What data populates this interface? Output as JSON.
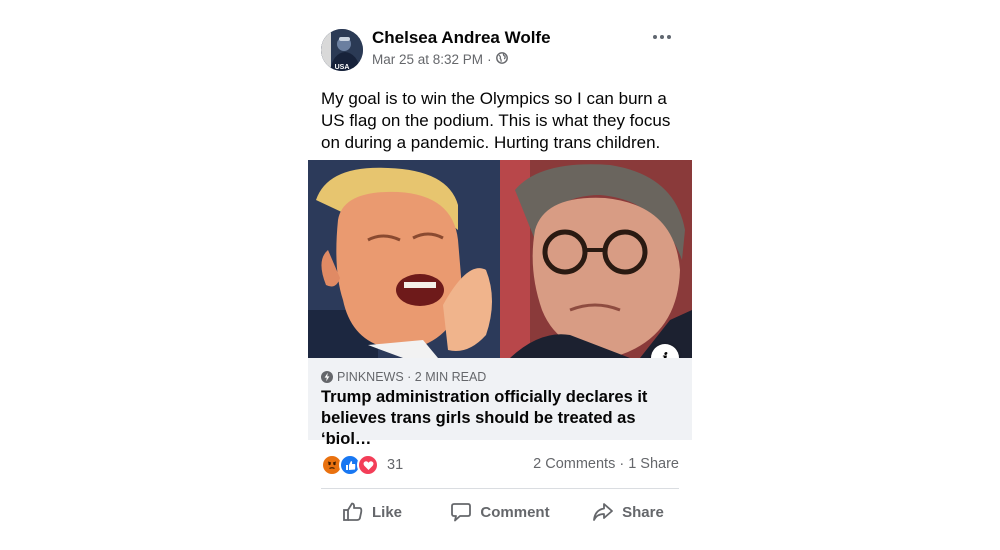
{
  "post": {
    "author": "Chelsea Andrea Wolfe",
    "date": "Mar 25 at 8:32 PM",
    "meta_separator": "·",
    "privacy_icon": "globe-icon",
    "avatar_text": "USA",
    "more_icon": "more-options-icon",
    "text": "My goal is to win the Olympics so I can burn a US flag on the podium. This is what they focus on during a pandemic. Hurting trans children."
  },
  "link_preview": {
    "source": "PinkNews · 2 min read",
    "headline": "Trump administration officially declares it believes trans girls should be treated as ‘biol…",
    "info_icon": "i"
  },
  "engagement": {
    "reaction_count": "31",
    "reactions": [
      "angry",
      "like",
      "love"
    ],
    "comments_shares": "2 Comments · 1 Share"
  },
  "actions": {
    "like": "Like",
    "comment": "Comment",
    "share": "Share"
  },
  "colors": {
    "like_blue": "#1877f2",
    "love_red": "#f33e58",
    "angry_orange": "#e9710f",
    "secondary_text": "#65676b"
  }
}
